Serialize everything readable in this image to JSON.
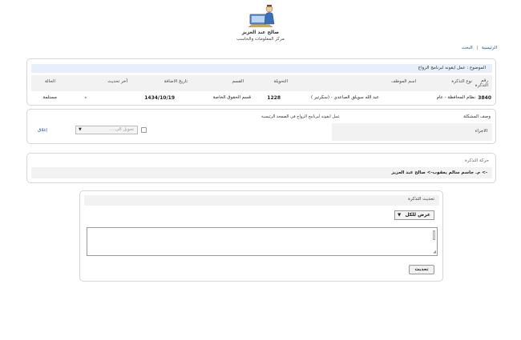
{
  "org": {
    "name": "صالح عبد العزيز",
    "subtitle": "مركز المعلومات والحاسب"
  },
  "nav": {
    "home": "الرئيسية",
    "separator": "|",
    "search": "البحث"
  },
  "ticket": {
    "subject": "الموضوع : عمل ايقونه لبرنامج الزواج",
    "headers": {
      "number": "رقم التذكرة",
      "type": "نوع التذكرة",
      "employee": "اسم الموظف",
      "transfer": "التحويلة",
      "section": "القسم",
      "added_date": "تاريخ الاضافة",
      "last_update": "آخر تحديث",
      "status": "الحالة"
    },
    "row": {
      "number": "3840",
      "type": "نظام المحافظة - عام",
      "employee": "عبد الله سويلق الصاعدي - (سكرتير )",
      "transfer": "1228",
      "section": "قسم الحقوق الخاصة",
      "added_date": "1434/10/19",
      "last_update": "-",
      "status": "مستلمة"
    }
  },
  "problem": {
    "label": "وصف المشكلة",
    "text": "عمل ايقونه لبرنامج الزواج في الصفحة الرئيسية",
    "action_label": "الاجراء",
    "transfer_placeholder": "تحويل الى....",
    "close_link": "إغلاق"
  },
  "movement": {
    "label": "حركة التذكرة",
    "text": "-> م. جاسم سالم يعقوب-> صالح عبد العزيز"
  },
  "update": {
    "label": "تحديث التذكرة",
    "view_option": "عرض للكل",
    "button": "تحديث"
  },
  "icons": {
    "logo": "computer-user-icon",
    "dropdown": "chevron-down-icon"
  }
}
